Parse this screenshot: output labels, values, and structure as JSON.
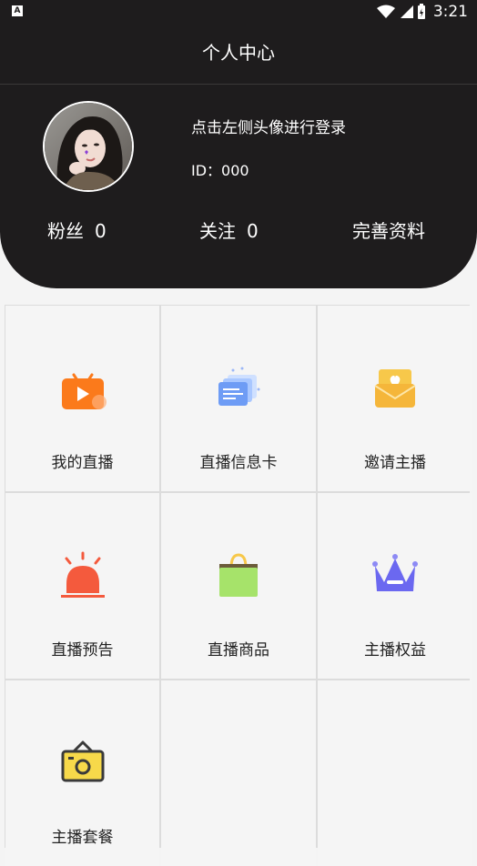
{
  "status": {
    "time": "3:21"
  },
  "header": {
    "title": "个人中心"
  },
  "profile": {
    "login_prompt": "点击左侧头像进行登录",
    "id_label": "ID：000",
    "fans_label": "粉丝",
    "fans_count": "0",
    "follow_label": "关注",
    "follow_count": "0",
    "complete_profile": "完善资料"
  },
  "menu": [
    {
      "label": "我的直播",
      "icon": "live-tv-icon"
    },
    {
      "label": "直播信息卡",
      "icon": "info-card-icon"
    },
    {
      "label": "邀请主播",
      "icon": "invite-envelope-icon"
    },
    {
      "label": "直播预告",
      "icon": "alarm-light-icon"
    },
    {
      "label": "直播商品",
      "icon": "shopping-bag-icon"
    },
    {
      "label": "主播权益",
      "icon": "crown-icon"
    },
    {
      "label": "主播套餐",
      "icon": "package-camera-icon"
    }
  ],
  "colors": {
    "header_bg": "#1e1c1d",
    "orange": "#fb7a1b",
    "red": "#f45a3d",
    "green": "#a6e36a",
    "purple": "#6b68f0",
    "yellow": "#f7c84a"
  }
}
